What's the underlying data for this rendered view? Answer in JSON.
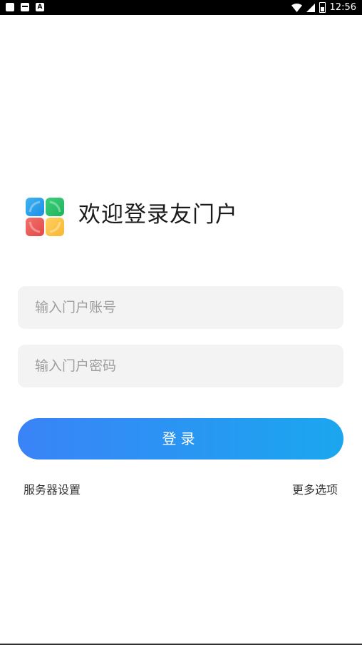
{
  "status_bar": {
    "time": "12:56",
    "icons": [
      "notification-icon",
      "sim-icon",
      "a-icon",
      "wifi-icon",
      "signal-icon",
      "battery-icon"
    ]
  },
  "header": {
    "title": "欢迎登录友门户",
    "logo_icon": "app-logo-icon"
  },
  "form": {
    "account_placeholder": "输入门户账号",
    "password_placeholder": "输入门户密码",
    "account_value": "",
    "password_value": ""
  },
  "actions": {
    "login_label": "登录",
    "server_settings_label": "服务器设置",
    "more_options_label": "更多选项"
  },
  "colors": {
    "button_start": "#3a83f7",
    "button_end": "#1aa7ef",
    "field_bg": "#f3f3f3"
  }
}
